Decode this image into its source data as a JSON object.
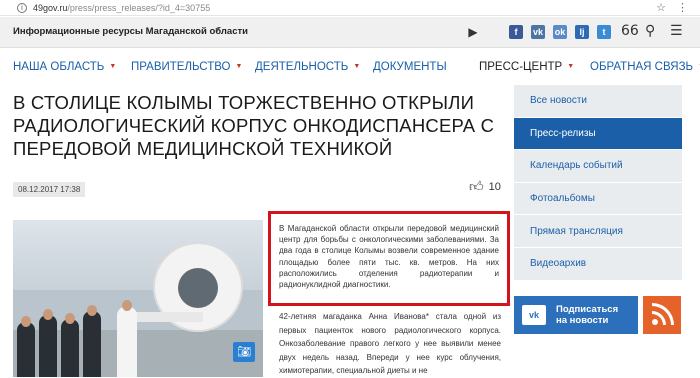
{
  "browser": {
    "url_host": "49gov.ru",
    "url_path": "/press/press_releases/?id_4=30755"
  },
  "topbar": {
    "info_label": "Информационные ресурсы Магаданской области",
    "social": [
      {
        "name": "facebook",
        "glyph": "f",
        "color": "#3b5998"
      },
      {
        "name": "vk",
        "glyph": "vk",
        "color": "#4c75a3"
      },
      {
        "name": "odnoklassniki",
        "glyph": "ok",
        "color": "#5b8bc4"
      },
      {
        "name": "livejournal",
        "glyph": "lj",
        "color": "#2f6ab7"
      },
      {
        "name": "twitter",
        "glyph": "t",
        "color": "#3a8bd3"
      }
    ]
  },
  "nav": {
    "items": [
      {
        "label": "НАША ОБЛАСТЬ",
        "has_menu": true
      },
      {
        "label": "ПРАВИТЕЛЬСТВО",
        "has_menu": true
      },
      {
        "label": "ДЕЯТЕЛЬНОСТЬ",
        "has_menu": true
      },
      {
        "label": "ДОКУМЕНТЫ",
        "has_menu": false
      },
      {
        "label": "ПРЕСС-ЦЕНТР",
        "has_menu": true
      },
      {
        "label": "ОБРАТНАЯ СВЯЗЬ",
        "has_menu": true
      }
    ]
  },
  "article": {
    "title": "В столице Колымы торжественно открыли радиологический корпус онкодиспансера с передовой медицинской техникой",
    "date": "08.12.2017 17:38",
    "likes": "10",
    "lead": "В Магаданской области открыли передовой медицинский центр для борьбы с онкологическими заболеваниями. За два года в столице Колымы возвели современное здание площадью более пяти тыс. кв. метров. На них расположились отделения радиотерапии и радионуклидной диагностики.",
    "body": "42-летняя магаданка Анна Иванова* стала одной из первых пациенток нового радиологического корпуса. Онкозаболевание правого легкого у нее выявили менее двух недель назад. Впереди у нее курс облучения, химиотерапии, специальной диеты и не"
  },
  "sidebar": {
    "items": [
      {
        "label": "Все новости",
        "active": false
      },
      {
        "label": "Пресс-релизы",
        "active": true
      },
      {
        "label": "Календарь событий",
        "active": false
      },
      {
        "label": "Фотоальбомы",
        "active": false
      },
      {
        "label": "Прямая трансляция",
        "active": false
      },
      {
        "label": "Видеоархив",
        "active": false
      }
    ],
    "subscribe_line1": "Подписаться",
    "subscribe_line2": "на новости"
  },
  "colors": {
    "accent": "#1a5fa8",
    "highlight_border": "#d4141c",
    "rss": "#e5632b"
  }
}
